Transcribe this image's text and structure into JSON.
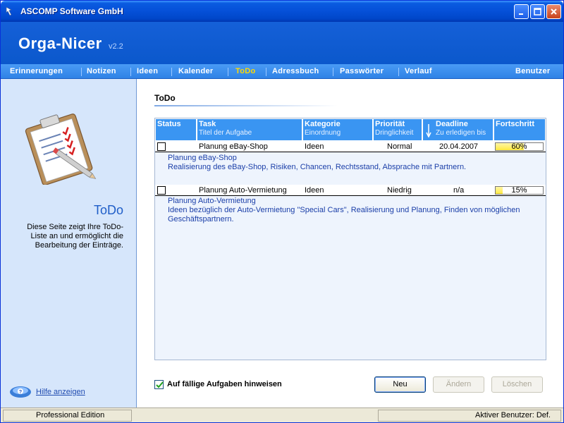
{
  "window": {
    "title": "ASCOMP Software GmbH"
  },
  "header": {
    "product": "Orga-Nicer",
    "version": "v2.2"
  },
  "nav": {
    "items": [
      "Erinnerungen",
      "Notizen",
      "Ideen",
      "Kalender",
      "ToDo",
      "Adressbuch",
      "Passwörter",
      "Verlauf"
    ],
    "active": "ToDo",
    "user": "Benutzer"
  },
  "left": {
    "title": "ToDo",
    "description": "Diese Seite zeigt Ihre ToDo-Liste an und ermöglicht die Bearbeitung der Einträge.",
    "help": "Hilfe anzeigen"
  },
  "main": {
    "section_title": "ToDo",
    "columns": [
      {
        "title": "Status",
        "sub": ""
      },
      {
        "title": "Task",
        "sub": "Titel der Aufgabe"
      },
      {
        "title": "Kategorie",
        "sub": "Einordnung"
      },
      {
        "title": "Priorität",
        "sub": "Dringlichkeit"
      },
      {
        "title": "Deadline",
        "sub": "Zu erledigen bis"
      },
      {
        "title": "Fortschritt",
        "sub": ""
      }
    ],
    "rows": [
      {
        "task": "Planung eBay-Shop",
        "category": "Ideen",
        "priority": "Normal",
        "deadline": "20.04.2007",
        "progress_label": "60%",
        "progress": 0.6,
        "detail_title": "Planung eBay-Shop",
        "detail_text": "Realisierung des eBay-Shop, Risiken, Chancen, Rechtsstand, Absprache mit Partnern."
      },
      {
        "task": "Planung Auto-Vermietung",
        "category": "Ideen",
        "priority": "Niedrig",
        "deadline": "n/a",
        "progress_label": "15%",
        "progress": 0.15,
        "detail_title": "Planung Auto-Vermietung",
        "detail_text": "Ideen bezüglich der Auto-Vermietung \"Special Cars\", Realisierung und Planung, Finden von möglichen",
        "detail_text2": "Geschäftspartnern."
      }
    ],
    "remind_label": "Auf fällige Aufgaben hinweisen",
    "remind_checked": true,
    "buttons": {
      "new": "Neu",
      "edit": "Ändern",
      "delete": "Löschen"
    }
  },
  "status": {
    "edition": "Professional Edition",
    "user": "Aktiver Benutzer: Def."
  },
  "colors": {
    "accent": "#0b58cc",
    "nav": "#3b8ff0",
    "header_cell": "#3a95f2",
    "active_nav": "#ffd800"
  }
}
